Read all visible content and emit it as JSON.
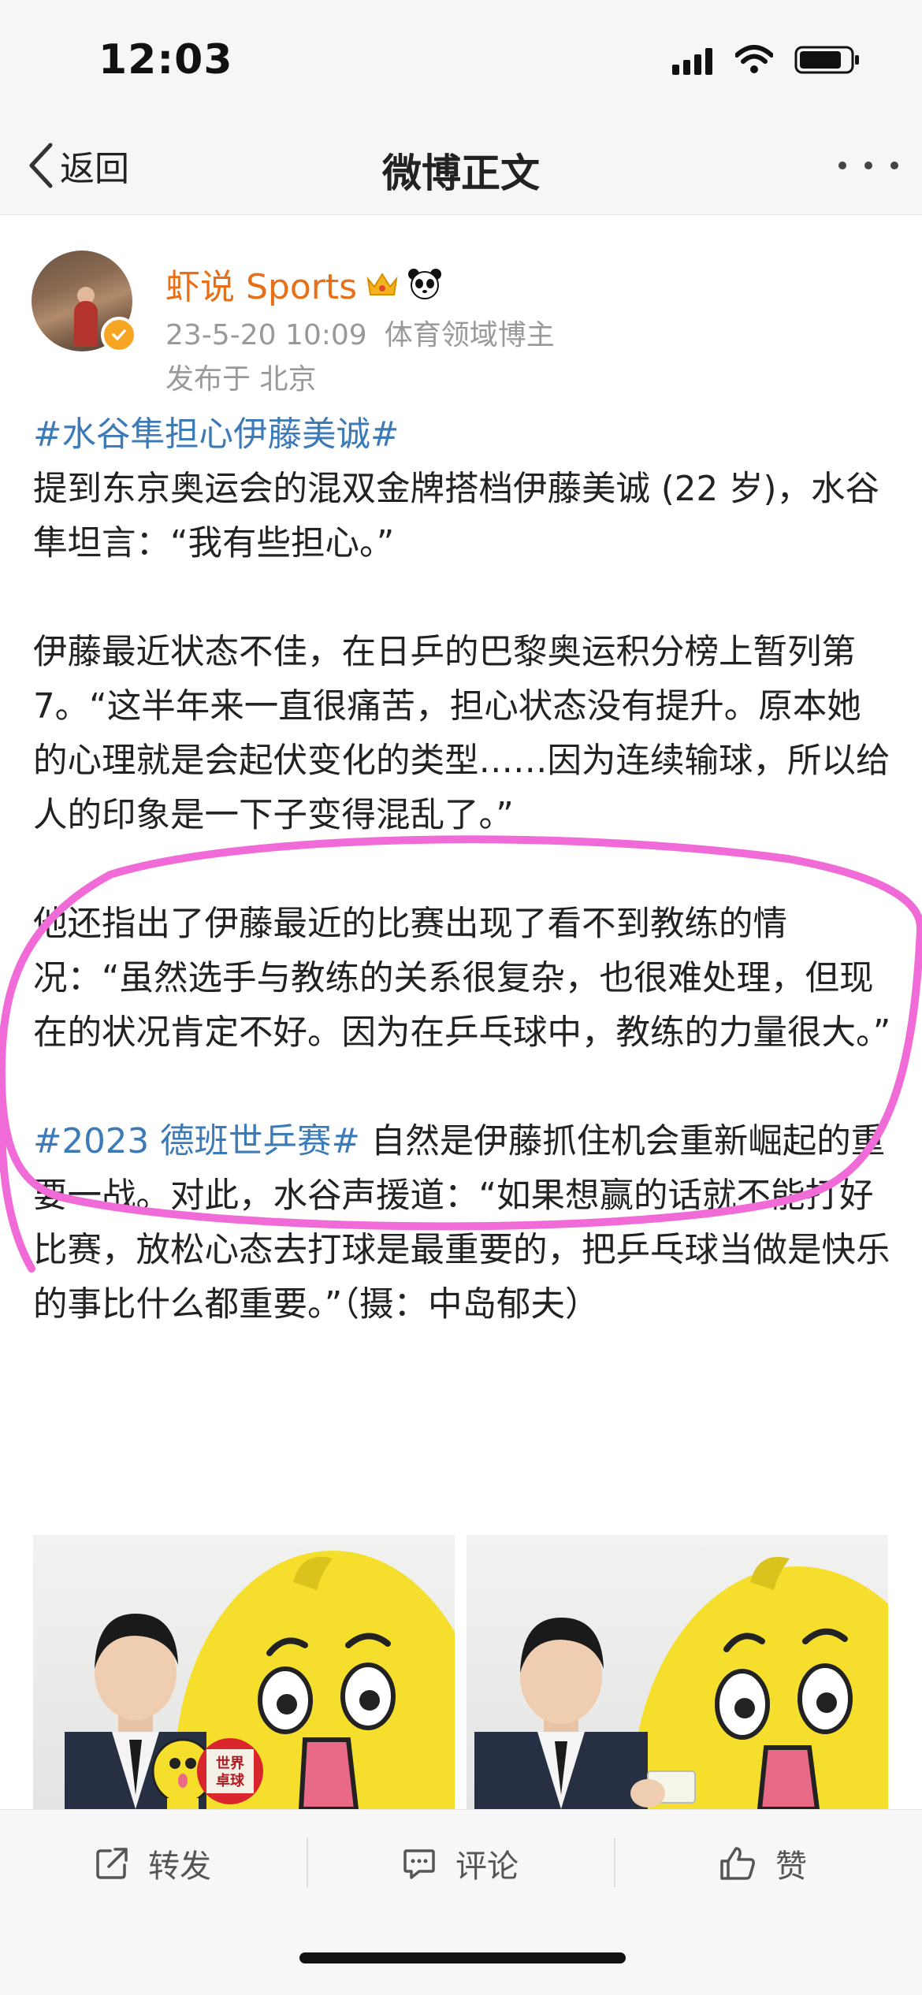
{
  "status_bar": {
    "time": "12:03"
  },
  "nav": {
    "back_label": "返回",
    "title": "微博正文"
  },
  "author": {
    "name": "虾说 Sports",
    "timestamp": "23-5-20 10:09",
    "role": "体育领域博主",
    "location": "发布于 北京"
  },
  "post": {
    "topic1": "#水谷隼担心伊藤美诚#",
    "p1": "提到东京奥运会的混双金牌搭档伊藤美诚 (22 岁)，水谷隼坦言：“我有些担心。”",
    "p2": "伊藤最近状态不佳，在日乒的巴黎奥运积分榜上暂列第 7。“这半年来一直很痛苦，担心状态没有提升。原本她的心理就是会起伏变化的类型……因为连续输球，所以给人的印象是一下子变得混乱了。”",
    "p3": "他还指出了伊藤最近的比赛出现了看不到教练的情况：“虽然选手与教练的关系很复杂，也很难处理，但现在的状况肯定不好。因为在乒乓球中，教练的力量很大。”",
    "topic2": "#2023 德班世乒赛#",
    "p4": " 自然是伊藤抓住机会重新崛起的重要一战。对此，水谷声援道：“如果想赢的话就不能打好比赛，放松心态去打球是最重要的，把乒乓球当做是快乐的事比什么都重要。”（摄：中岛郁夫）"
  },
  "photo_sign": {
    "line1": "世界",
    "line2": "卓球"
  },
  "toolbar": {
    "repost_label": "转发",
    "comment_label": "评论",
    "like_label": "赞"
  },
  "colors": {
    "accent_link": "#3d7ab8",
    "username": "#e86f16",
    "annotation": "#f06ad8"
  },
  "icons": {
    "back": "chevron-left-icon",
    "more": "more-dots-icon",
    "repost": "share-icon",
    "comment": "comment-icon",
    "like": "thumbs-up-icon"
  }
}
